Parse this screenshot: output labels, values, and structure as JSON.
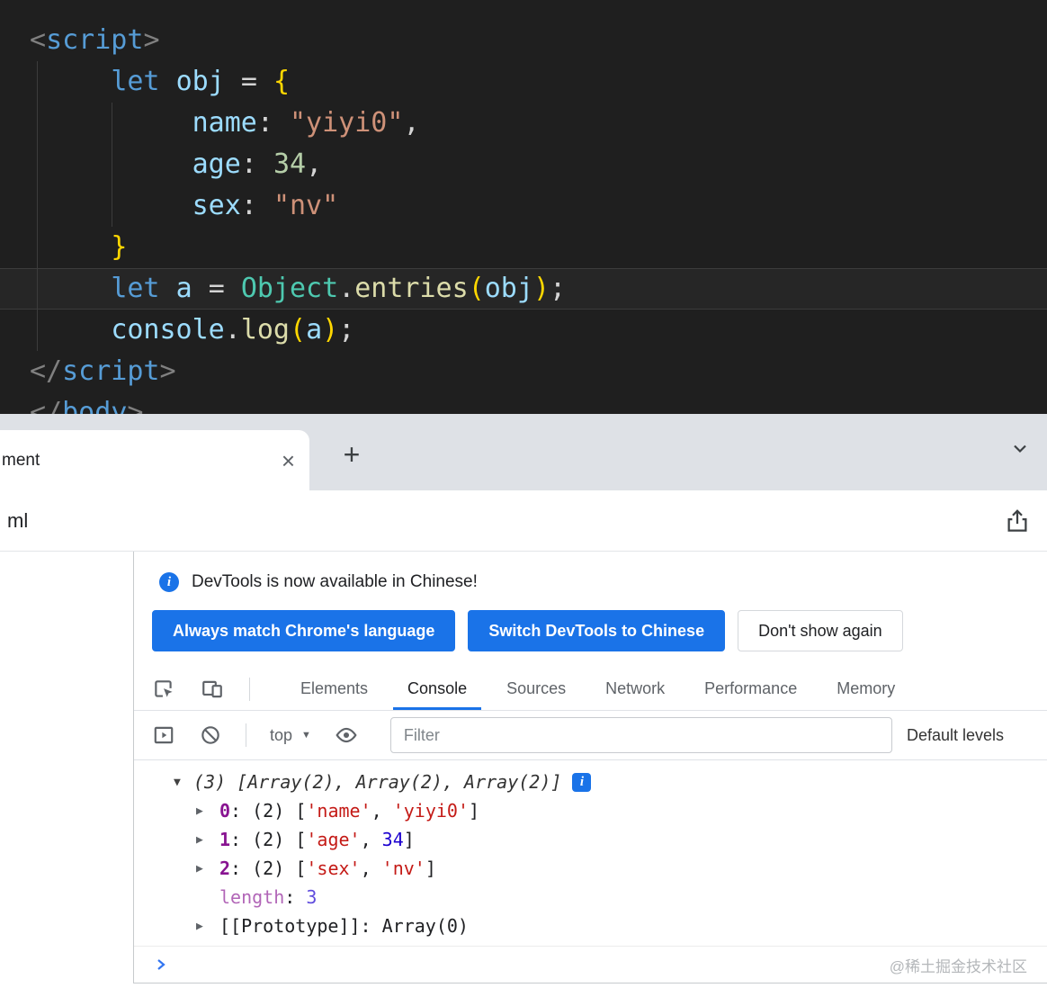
{
  "editor": {
    "background": "#1f1f1f",
    "lines": [
      [
        [
          "<",
          "punct"
        ],
        [
          "script",
          "tag"
        ],
        [
          ">",
          "punct"
        ]
      ],
      [
        [
          "     ",
          "plain"
        ],
        [
          "let",
          "kw"
        ],
        [
          " ",
          "plain"
        ],
        [
          "obj",
          "var"
        ],
        [
          " ",
          "plain"
        ],
        [
          "=",
          "op"
        ],
        [
          " ",
          "plain"
        ],
        [
          "{",
          "brace"
        ]
      ],
      [
        [
          "          ",
          "plain"
        ],
        [
          "name",
          "var"
        ],
        [
          ":",
          "op"
        ],
        [
          " ",
          "plain"
        ],
        [
          "\"yiyi0\"",
          "str"
        ],
        [
          ",",
          "op"
        ]
      ],
      [
        [
          "          ",
          "plain"
        ],
        [
          "age",
          "var"
        ],
        [
          ":",
          "op"
        ],
        [
          " ",
          "plain"
        ],
        [
          "34",
          "num"
        ],
        [
          ",",
          "op"
        ]
      ],
      [
        [
          "          ",
          "plain"
        ],
        [
          "sex",
          "var"
        ],
        [
          ":",
          "op"
        ],
        [
          " ",
          "plain"
        ],
        [
          "\"nv\"",
          "str"
        ]
      ],
      [
        [
          "     ",
          "plain"
        ],
        [
          "}",
          "brace"
        ]
      ],
      [
        [
          "     ",
          "plain"
        ],
        [
          "let",
          "kw"
        ],
        [
          " ",
          "plain"
        ],
        [
          "a",
          "var"
        ],
        [
          " ",
          "plain"
        ],
        [
          "=",
          "op"
        ],
        [
          " ",
          "plain"
        ],
        [
          "Object",
          "class"
        ],
        [
          ".",
          "op"
        ],
        [
          "entries",
          "fn"
        ],
        [
          "(",
          "paren"
        ],
        [
          "obj",
          "var"
        ],
        [
          ")",
          "paren"
        ],
        [
          ";",
          "op"
        ]
      ],
      [
        [
          "     ",
          "plain"
        ],
        [
          "console",
          "var"
        ],
        [
          ".",
          "op"
        ],
        [
          "log",
          "fn"
        ],
        [
          "(",
          "paren"
        ],
        [
          "a",
          "var"
        ],
        [
          ")",
          "paren"
        ],
        [
          ";",
          "op"
        ]
      ],
      [
        [
          "</",
          "punct"
        ],
        [
          "script",
          "tag"
        ],
        [
          ">",
          "punct"
        ]
      ],
      [
        [
          "</",
          "punct"
        ],
        [
          "body",
          "tag"
        ],
        [
          ">",
          "punct"
        ]
      ]
    ]
  },
  "browser": {
    "tab_title": "ment",
    "tab_close_glyph": "×",
    "new_tab_glyph": "+",
    "url_text": "ml"
  },
  "devtools": {
    "accent_color": "#1a73e8",
    "banner": {
      "message": "DevTools is now available in Chinese!",
      "buttons": [
        {
          "label": "Always match Chrome's language",
          "style": "primary"
        },
        {
          "label": "Switch DevTools to Chinese",
          "style": "primary"
        },
        {
          "label": "Don't show again",
          "style": "secondary"
        }
      ]
    },
    "tabs": [
      {
        "label": "Elements",
        "active": false
      },
      {
        "label": "Console",
        "active": true
      },
      {
        "label": "Sources",
        "active": false
      },
      {
        "label": "Network",
        "active": false
      },
      {
        "label": "Performance",
        "active": false
      },
      {
        "label": "Memory",
        "active": false
      }
    ],
    "console_toolbar": {
      "context_label": "top",
      "caret_glyph": "▼",
      "filter_placeholder": "Filter",
      "levels_label": "Default levels"
    },
    "console_rows": [
      {
        "expander": "expanded",
        "indent": 0,
        "badge": true,
        "tokens": [
          [
            "(3) [Array(2), Array(2), Array(2)]",
            "preview"
          ]
        ]
      },
      {
        "expander": "collapsed",
        "indent": 1,
        "tokens": [
          [
            "0",
            "key"
          ],
          [
            ": ",
            "plain"
          ],
          [
            "(2) ",
            "plain"
          ],
          [
            "[",
            "plain"
          ],
          [
            "'name'",
            "str"
          ],
          [
            ", ",
            "plain"
          ],
          [
            "'yiyi0'",
            "str"
          ],
          [
            "]",
            "plain"
          ]
        ]
      },
      {
        "expander": "collapsed",
        "indent": 1,
        "tokens": [
          [
            "1",
            "key"
          ],
          [
            ": ",
            "plain"
          ],
          [
            "(2) ",
            "plain"
          ],
          [
            "[",
            "plain"
          ],
          [
            "'age'",
            "str"
          ],
          [
            ", ",
            "plain"
          ],
          [
            "34",
            "num"
          ],
          [
            "]",
            "plain"
          ]
        ]
      },
      {
        "expander": "collapsed",
        "indent": 1,
        "tokens": [
          [
            "2",
            "key"
          ],
          [
            ": ",
            "plain"
          ],
          [
            "(2) ",
            "plain"
          ],
          [
            "[",
            "plain"
          ],
          [
            "'sex'",
            "str"
          ],
          [
            ", ",
            "plain"
          ],
          [
            "'nv'",
            "str"
          ],
          [
            "]",
            "plain"
          ]
        ]
      },
      {
        "expander": "none",
        "indent": 1,
        "tokens": [
          [
            "length",
            "faded-key"
          ],
          [
            ": ",
            "plain"
          ],
          [
            "3",
            "faded-num"
          ]
        ]
      },
      {
        "expander": "collapsed",
        "indent": 1,
        "tokens": [
          [
            "[[Prototype]]",
            "plain"
          ],
          [
            ": ",
            "plain"
          ],
          [
            "Array(0)",
            "plain"
          ]
        ]
      }
    ]
  },
  "watermark": "@稀土掘金技术社区"
}
